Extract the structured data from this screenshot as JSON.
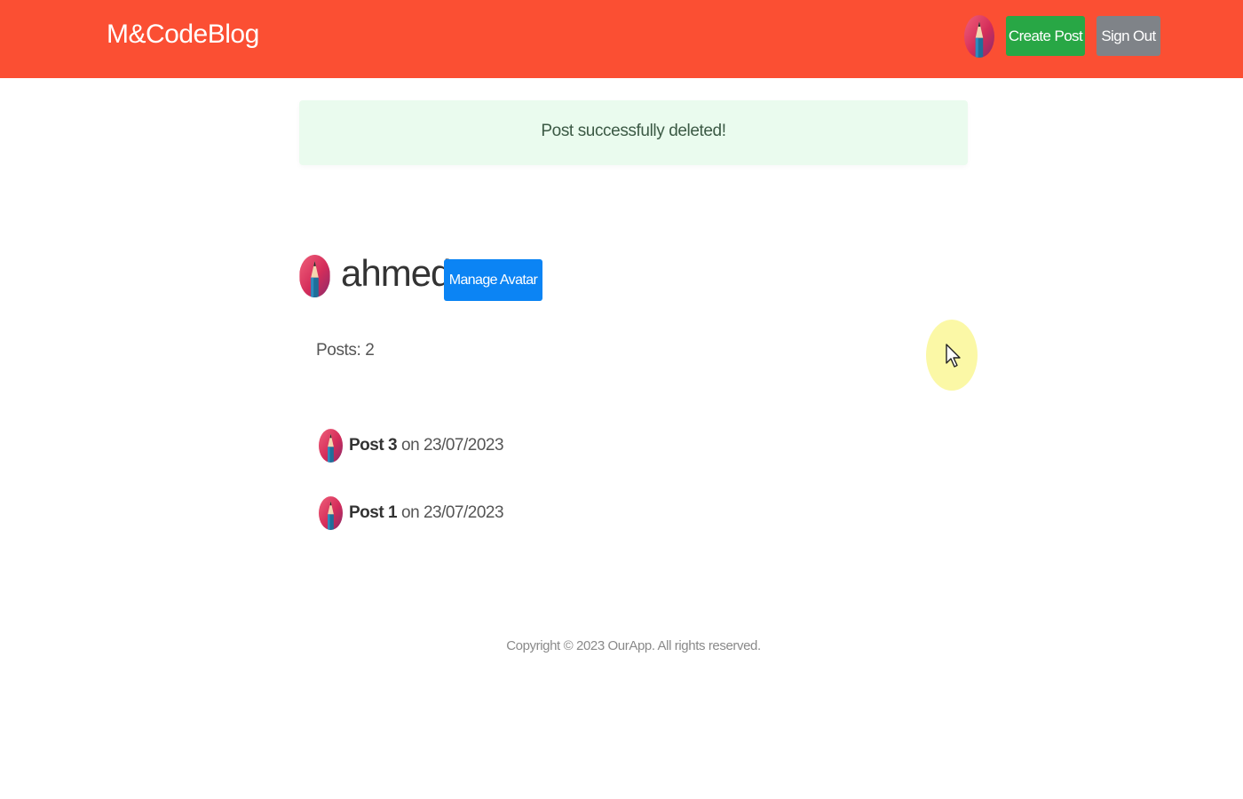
{
  "header": {
    "brand": "M&CodeBlog",
    "create_post_label": "Create Post",
    "sign_out_label": "Sign Out"
  },
  "alert": {
    "message": "Post successfully deleted!"
  },
  "profile": {
    "username": "ahmed",
    "manage_avatar_label": "Manage Avatar",
    "posts_count_label": "Posts: 2"
  },
  "posts": [
    {
      "title": "Post 3",
      "date_text": "on 23/07/2023"
    },
    {
      "title": "Post 1",
      "date_text": "on 23/07/2023"
    }
  ],
  "footer": {
    "copyright": "Copyright © 2023 OurApp. All rights reserved."
  },
  "colors": {
    "header_bg": "#fb4f33",
    "create_post_bg": "#28a745",
    "sign_out_bg": "#7f8388",
    "manage_avatar_bg": "#0b84f4",
    "alert_bg": "#eafbee"
  },
  "icons": {
    "avatar": "pencil-avatar-icon",
    "cursor": "mouse-pointer-icon"
  }
}
